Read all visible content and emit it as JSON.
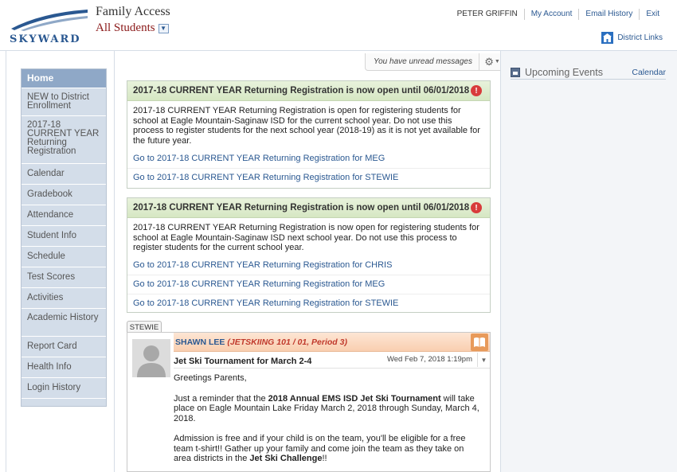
{
  "header": {
    "logo_text": "SKYWARD",
    "app_title": "Family Access",
    "student_selector": "All Students",
    "user_name": "PETER GRIFFIN",
    "my_account": "My Account",
    "email_history": "Email History",
    "exit": "Exit",
    "district_links": "District Links"
  },
  "sidebar": {
    "items": [
      {
        "label": "Home"
      },
      {
        "label": "NEW to District Enrollment"
      },
      {
        "label": "2017-18 CURRENT YEAR Returning Registration"
      },
      {
        "label": "Calendar"
      },
      {
        "label": "Gradebook"
      },
      {
        "label": "Attendance"
      },
      {
        "label": "Student Info"
      },
      {
        "label": "Schedule"
      },
      {
        "label": "Test Scores"
      },
      {
        "label": "Activities"
      },
      {
        "label": "Academic History"
      },
      {
        "label": "Report Card"
      },
      {
        "label": "Health Info"
      },
      {
        "label": "Login History"
      }
    ]
  },
  "messages": {
    "unread": "You have unread messages"
  },
  "panels": [
    {
      "title": "2017-18 CURRENT YEAR Returning Registration is now open until 06/01/2018",
      "alert": "!",
      "body": "2017-18 CURRENT YEAR Returning Registration is open for registering students for school at Eagle Mountain-Saginaw ISD for the current school year. Do not use this process to register students for the next school year (2018-19) as it is not yet available for the future year.",
      "links": [
        "Go to 2017-18 CURRENT YEAR Returning Registration for MEG",
        "Go to 2017-18 CURRENT YEAR Returning Registration for STEWIE"
      ]
    },
    {
      "title": "2017-18 CURRENT YEAR Returning Registration is now open until 06/01/2018",
      "alert": "!",
      "body": "2017-18 CURRENT YEAR Returning Registration is now open for registering students for school at Eagle Mountain-Saginaw ISD next school year. Do not use this process to register students for the current school year.",
      "links": [
        "Go to 2017-18 CURRENT YEAR Returning Registration for CHRIS",
        "Go to 2017-18 CURRENT YEAR Returning Registration for MEG",
        "Go to 2017-18 CURRENT YEAR Returning Registration for STEWIE"
      ]
    }
  ],
  "post": {
    "tab": "STEWIE",
    "author": "SHAWN LEE",
    "course": "(JETSKIING 101 / 01, Period 3)",
    "subject": "Jet Ski Tournament for March 2-4",
    "date": "Wed Feb 7, 2018 1:19pm",
    "greeting": "Greetings Parents,",
    "p1_a": "Just a reminder that the ",
    "p1_bold": "2018 Annual EMS ISD Jet Ski Tournament",
    "p1_b": " will take place on Eagle Mountain Lake Friday March 2, 2018 through Sunday, March 4, 2018.",
    "p2_a": "Admission is free and if your child is on the team, you'll be eligible for a free team t-shirt!! Gather up your family and come join the team as they take on area districts in the ",
    "p2_bold": "Jet Ski Challenge",
    "p2_b": "!!"
  },
  "events": {
    "title": "Upcoming Events",
    "calendar_link": "Calendar"
  },
  "colors": {
    "brand_blue": "#2a5891",
    "sidebar_bg": "#d3dde9",
    "home_active": "#8fa8c7",
    "panel_head": "#d6e7c3",
    "post_head": "#f9cfb0",
    "alert_red": "#d83b3b"
  }
}
